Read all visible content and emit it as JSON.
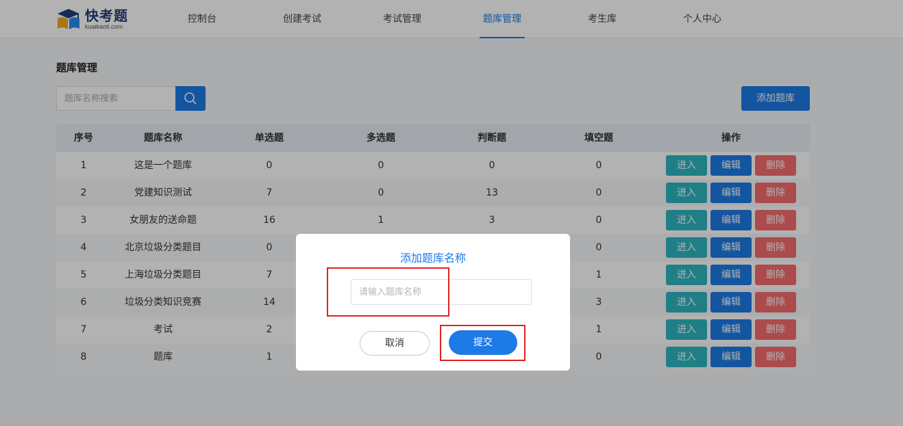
{
  "header": {
    "logo_name": "快考题",
    "logo_domain": "kuaikaoti.com",
    "nav": [
      {
        "label": "控制台",
        "active": false
      },
      {
        "label": "创建考试",
        "active": false
      },
      {
        "label": "考试管理",
        "active": false
      },
      {
        "label": "题库管理",
        "active": true
      },
      {
        "label": "考生库",
        "active": false
      },
      {
        "label": "个人中心",
        "active": false
      }
    ]
  },
  "page": {
    "title": "题库管理",
    "search_placeholder": "题库名称搜索",
    "add_label": "添加题库"
  },
  "table": {
    "columns": [
      "序号",
      "题库名称",
      "单选题",
      "多选题",
      "判断题",
      "填空题",
      "操作"
    ],
    "rows": [
      {
        "no": "1",
        "name": "这是一个题库",
        "single": "0",
        "multi": "0",
        "judge": "0",
        "fill": "0"
      },
      {
        "no": "2",
        "name": "党建知识测试",
        "single": "7",
        "multi": "0",
        "judge": "13",
        "fill": "0"
      },
      {
        "no": "3",
        "name": "女朋友的送命题",
        "single": "16",
        "multi": "1",
        "judge": "3",
        "fill": "0"
      },
      {
        "no": "4",
        "name": "北京垃圾分类题目",
        "single": "0",
        "multi": "",
        "judge": "",
        "fill": "0"
      },
      {
        "no": "5",
        "name": "上海垃圾分类题目",
        "single": "7",
        "multi": "",
        "judge": "",
        "fill": "1"
      },
      {
        "no": "6",
        "name": "垃圾分类知识竞赛",
        "single": "14",
        "multi": "",
        "judge": "",
        "fill": "3"
      },
      {
        "no": "7",
        "name": "考试",
        "single": "2",
        "multi": "",
        "judge": "",
        "fill": "1"
      },
      {
        "no": "8",
        "name": "题库",
        "single": "1",
        "multi": "",
        "judge": "",
        "fill": "0"
      }
    ],
    "op_labels": {
      "enter": "进入",
      "edit": "编辑",
      "delete": "删除"
    }
  },
  "modal": {
    "title": "添加题库名称",
    "input_placeholder": "请输入题库名称",
    "cancel_label": "取消",
    "submit_label": "提交"
  },
  "colors": {
    "primary": "#1e7ae6",
    "enter": "#2fb6c0",
    "delete": "#f56c6c",
    "highlight": "#e02020"
  }
}
